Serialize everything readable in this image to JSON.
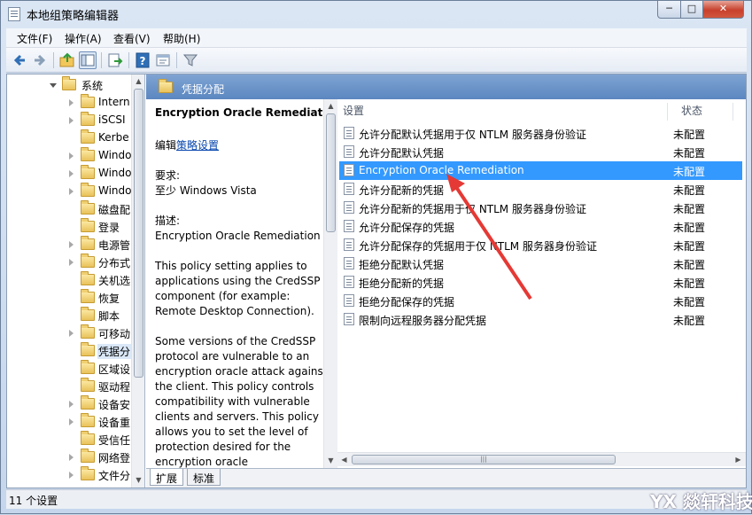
{
  "window": {
    "title": "本地组策略编辑器",
    "controls": {
      "minimize": "─",
      "maximize": "□",
      "close": "✕"
    }
  },
  "menu": [
    "文件(F)",
    "操作(A)",
    "查看(V)",
    "帮助(H)"
  ],
  "toolbar_icons": [
    "back-arrow-icon",
    "forward-arrow-icon",
    "up-folder-icon",
    "show-hide-tree-icon",
    "export-list-icon",
    "help-icon",
    "properties-icon",
    "filter-icon"
  ],
  "tree": {
    "root": "系统",
    "items": [
      "Intern",
      "iSCSI",
      "Kerbe",
      "Windo",
      "Windo",
      "Windo",
      "磁盘配",
      "登录",
      "电源管",
      "分布式",
      "关机选",
      "恢复",
      "脚本",
      "可移动",
      "凭据分",
      "区域设",
      "驱动程",
      "设备安",
      "设备重",
      "受信任",
      "网络登",
      "文件分"
    ]
  },
  "header": {
    "title": "凭据分配"
  },
  "description": {
    "policy_title": "Encryption Oracle Remediation",
    "edit_prefix": "编辑",
    "edit_link": "策略设置",
    "requirements_label": "要求:",
    "requirements": "至少 Windows Vista",
    "desc_label": "描述:",
    "desc_name": "Encryption Oracle Remediation",
    "para1": "This policy setting applies to applications using the CredSSP component (for example: Remote Desktop Connection).",
    "para2": "Some versions of the CredSSP protocol are vulnerable to an encryption oracle attack against the client.  This policy controls compatibility with vulnerable clients and servers.  This policy allows you to set the level of protection desired for the encryption oracle"
  },
  "list": {
    "col_setting": "设置",
    "col_state": "状态",
    "rows": [
      {
        "name": "允许分配默认凭据用于仅 NTLM 服务器身份验证",
        "state": "未配置"
      },
      {
        "name": "允许分配默认凭据",
        "state": "未配置"
      },
      {
        "name": "Encryption Oracle Remediation",
        "state": "未配置"
      },
      {
        "name": "允许分配新的凭据",
        "state": "未配置"
      },
      {
        "name": "允许分配新的凭据用于仅 NTLM 服务器身份验证",
        "state": "未配置"
      },
      {
        "name": "允许分配保存的凭据",
        "state": "未配置"
      },
      {
        "name": "允许分配保存的凭据用于仅 NTLM 服务器身份验证",
        "state": "未配置"
      },
      {
        "name": "拒绝分配默认凭据",
        "state": "未配置"
      },
      {
        "name": "拒绝分配新的凭据",
        "state": "未配置"
      },
      {
        "name": "拒绝分配保存的凭据",
        "state": "未配置"
      },
      {
        "name": "限制向远程服务器分配凭据",
        "state": "未配置"
      }
    ]
  },
  "tabs": [
    "扩展",
    "标准"
  ],
  "status": "11 个设置",
  "watermark": "YX 燚轩科技",
  "colors": {
    "selection": "#3399ff",
    "header": "#5b86c0",
    "annotation_arrow": "#e53935"
  }
}
